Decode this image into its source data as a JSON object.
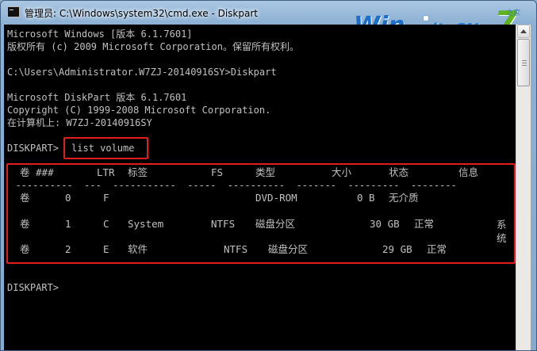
{
  "window": {
    "title": "管理员: C:\\Windows\\system32\\cmd.exe - Diskpart"
  },
  "watermark": {
    "brand": "Win",
    "site": "itsCN.com",
    "seven": "7",
    "small": "之家"
  },
  "console": {
    "lines": [
      "Microsoft Windows [版本 6.1.7601]",
      "版权所有 (c) 2009 Microsoft Corporation。保留所有权利。",
      "C:\\Users\\Administrator.W7ZJ-20140916SY>Diskpart",
      "Microsoft DiskPart 版本 6.1.7601",
      "Copyright (C) 1999-2008 Microsoft Corporation.",
      "在计算机上: W7ZJ-20140916SY",
      "DISKPART>"
    ],
    "prompt": "DISKPART>",
    "command": "list volume",
    "final_prompt": "DISKPART>"
  },
  "volume_table": {
    "headers": [
      "卷 ###",
      "LTR",
      "标签",
      "FS",
      "类型",
      "大小",
      "状态",
      "信息"
    ],
    "separator": "  ----------  ---  -----------  -----  ----------  -------  ---------  --------",
    "rows": [
      [
        "卷",
        "0",
        "F",
        "",
        "",
        "DVD-ROM",
        "0 B",
        "无介质",
        ""
      ],
      [
        "卷",
        "1",
        "C",
        "System",
        "NTFS",
        "磁盘分区",
        "30 GB",
        "正常",
        "系统"
      ],
      [
        "卷",
        "2",
        "E",
        "软件",
        "NTFS",
        "磁盘分区",
        "29 GB",
        "正常",
        ""
      ]
    ]
  },
  "colors": {
    "console_bg": "#000000",
    "console_text": "#c0c0c0",
    "highlight": "#e01e1e"
  }
}
